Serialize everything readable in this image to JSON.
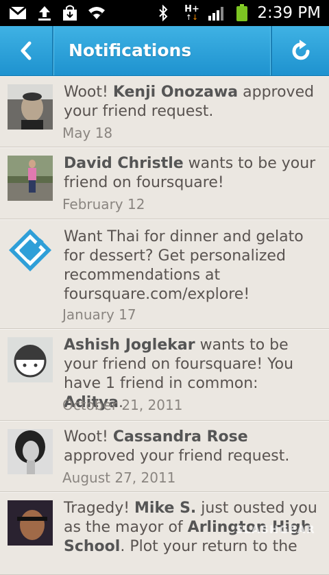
{
  "status_bar": {
    "time": "2:39 PM",
    "network": "H+",
    "icons": [
      "gmail-icon",
      "upload-icon",
      "shopping-bag-icon",
      "wifi-icon",
      "bluetooth-icon",
      "network-icon",
      "signal-icon",
      "battery-icon"
    ]
  },
  "action_bar": {
    "title": "Notifications",
    "back_icon": "chevron-left-icon",
    "refresh_icon": "refresh-icon",
    "color": "#2aa3dc"
  },
  "notifications": [
    {
      "avatar": "photo-man-smiling",
      "segments": [
        {
          "t": "Woot! ",
          "b": false
        },
        {
          "t": "Kenji Onozawa",
          "b": true
        },
        {
          "t": " approved your friend request.",
          "b": false
        }
      ],
      "date": "May 18"
    },
    {
      "avatar": "photo-person-garden",
      "segments": [
        {
          "t": "David Christle",
          "b": true
        },
        {
          "t": " wants to be your friend on foursquare!",
          "b": false
        }
      ],
      "date": "February 12"
    },
    {
      "avatar": "foursquare-checkmark-logo",
      "segments": [
        {
          "t": "Want Thai for dinner and gelato for dessert? Get personalized recommendations at foursquare.com/explore!",
          "b": false
        }
      ],
      "date": "January 17"
    },
    {
      "avatar": "default-user-avatar",
      "segments": [
        {
          "t": "Ashish Joglekar",
          "b": true
        },
        {
          "t": " wants to be your friend on foursquare! You have 1 friend in common: ",
          "b": false
        },
        {
          "t": "Aditya",
          "b": true
        },
        {
          "t": ".",
          "b": false
        }
      ],
      "date": "October 21, 2011"
    },
    {
      "avatar": "photo-woman-bw",
      "segments": [
        {
          "t": "Woot! ",
          "b": false
        },
        {
          "t": "Cassandra Rose",
          "b": true
        },
        {
          "t": " approved your friend request.",
          "b": false
        }
      ],
      "date": "August 27, 2011"
    },
    {
      "avatar": "photo-man-dark",
      "segments": [
        {
          "t": "Tragedy! ",
          "b": false
        },
        {
          "t": "Mike S.",
          "b": true
        },
        {
          "t": " just ousted you as the mayor of ",
          "b": false
        },
        {
          "t": "Arlington High School",
          "b": true
        },
        {
          "t": ". Plot your return to the",
          "b": false
        }
      ],
      "date": ""
    }
  ],
  "watermark": "SLASHGEAR"
}
